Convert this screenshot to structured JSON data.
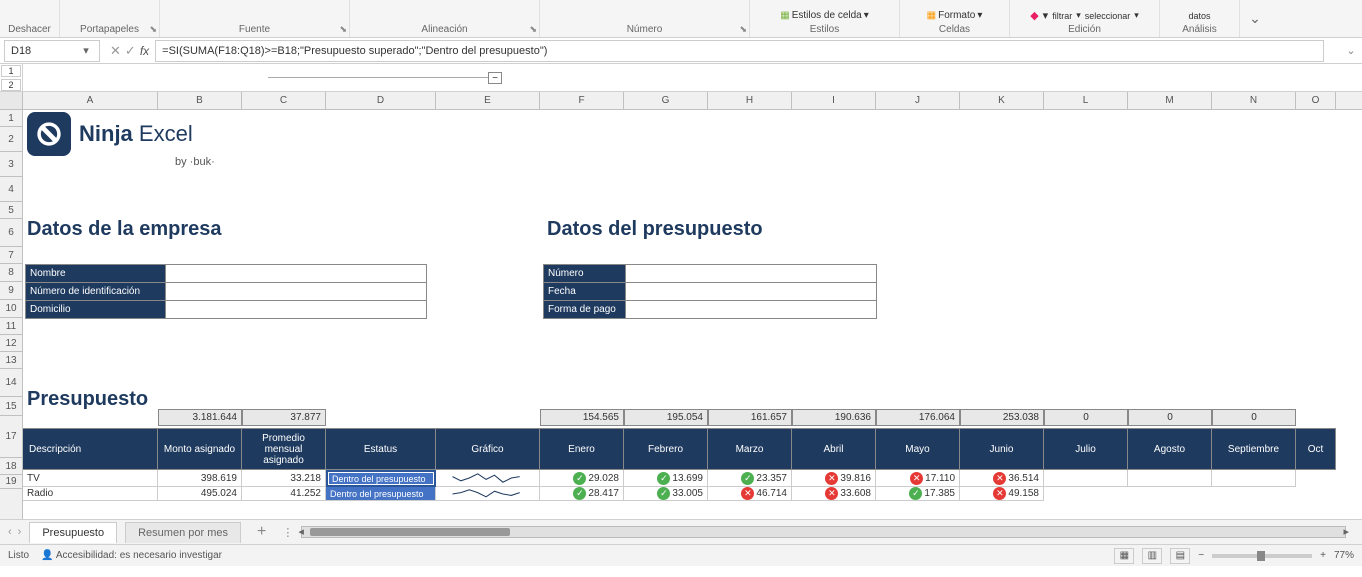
{
  "ribbon": {
    "undo": "Deshacer",
    "clipboard": "Portapapeles",
    "font": "Fuente",
    "alignment": "Alineación",
    "number": "Número",
    "styles": "Estilos",
    "styles_cells": "Estilos de celda",
    "cells": "Celdas",
    "format": "Formato",
    "editing": "Edición",
    "filter": "filtrar",
    "select": "seleccionar",
    "data": "datos",
    "analysis": "Análisis"
  },
  "namebox": "D18",
  "formula": "=SI(SUMA(F18:Q18)>=B18;\"Presupuesto superado\";\"Dentro del presupuesto\")",
  "outline": {
    "levels": [
      "1",
      "2"
    ],
    "collapse": "−"
  },
  "cols": [
    "A",
    "B",
    "C",
    "D",
    "E",
    "F",
    "G",
    "H",
    "I",
    "J",
    "K",
    "L",
    "M",
    "N",
    "O"
  ],
  "rows": [
    "1",
    "2",
    "3",
    "4",
    "5",
    "6",
    "7",
    "8",
    "9",
    "10",
    "11",
    "12",
    "13",
    "14",
    "15",
    "17",
    "18",
    "19"
  ],
  "logo": {
    "brand": "Ninja",
    "product": "Excel",
    "by": "by ·buk·"
  },
  "sections": {
    "company": "Datos de la empresa",
    "budget_info": "Datos del presupuesto",
    "budget": "Presupuesto"
  },
  "company_fields": {
    "name": "Nombre",
    "id": "Número de identificación",
    "address": "Domicilio"
  },
  "budget_fields": {
    "number": "Número",
    "date": "Fecha",
    "payment": "Forma de pago"
  },
  "totals": {
    "b": "3.181.644",
    "c": "37.877",
    "f": "154.565",
    "g": "195.054",
    "h": "161.657",
    "i": "190.636",
    "j": "176.064",
    "k": "253.038",
    "l": "0",
    "m": "0",
    "n": "0"
  },
  "headers": {
    "desc": "Descripción",
    "amount": "Monto asignado",
    "avg": "Promedio mensual asignado",
    "status": "Estatus",
    "chart": "Gráfico",
    "months": [
      "Enero",
      "Febrero",
      "Marzo",
      "Abril",
      "Mayo",
      "Junio",
      "Julio",
      "Agosto",
      "Septiembre",
      "Oct"
    ]
  },
  "data_rows": [
    {
      "desc": "TV",
      "amount": "398.619",
      "avg": "33.218",
      "status": "Dentro del presupuesto",
      "m": [
        {
          "v": "29.028",
          "ok": true
        },
        {
          "v": "13.699",
          "ok": true
        },
        {
          "v": "23.357",
          "ok": true
        },
        {
          "v": "39.816",
          "ok": false
        },
        {
          "v": "17.110",
          "ok": false
        },
        {
          "v": "36.514",
          "ok": false
        }
      ]
    },
    {
      "desc": "Radio",
      "amount": "495.024",
      "avg": "41.252",
      "status": "Dentro del presupuesto",
      "m": [
        {
          "v": "28.417",
          "ok": true
        },
        {
          "v": "33.005",
          "ok": true
        },
        {
          "v": "46.714",
          "ok": false
        },
        {
          "v": "33.608",
          "ok": false
        },
        {
          "v": "17.385",
          "ok": true
        },
        {
          "v": "49.158",
          "ok": false
        }
      ]
    }
  ],
  "sheets": {
    "active": "Presupuesto",
    "other": "Resumen por mes"
  },
  "status": {
    "ready": "Listo",
    "accessibility": "Accesibilidad: es necesario investigar",
    "zoom": "77%"
  }
}
